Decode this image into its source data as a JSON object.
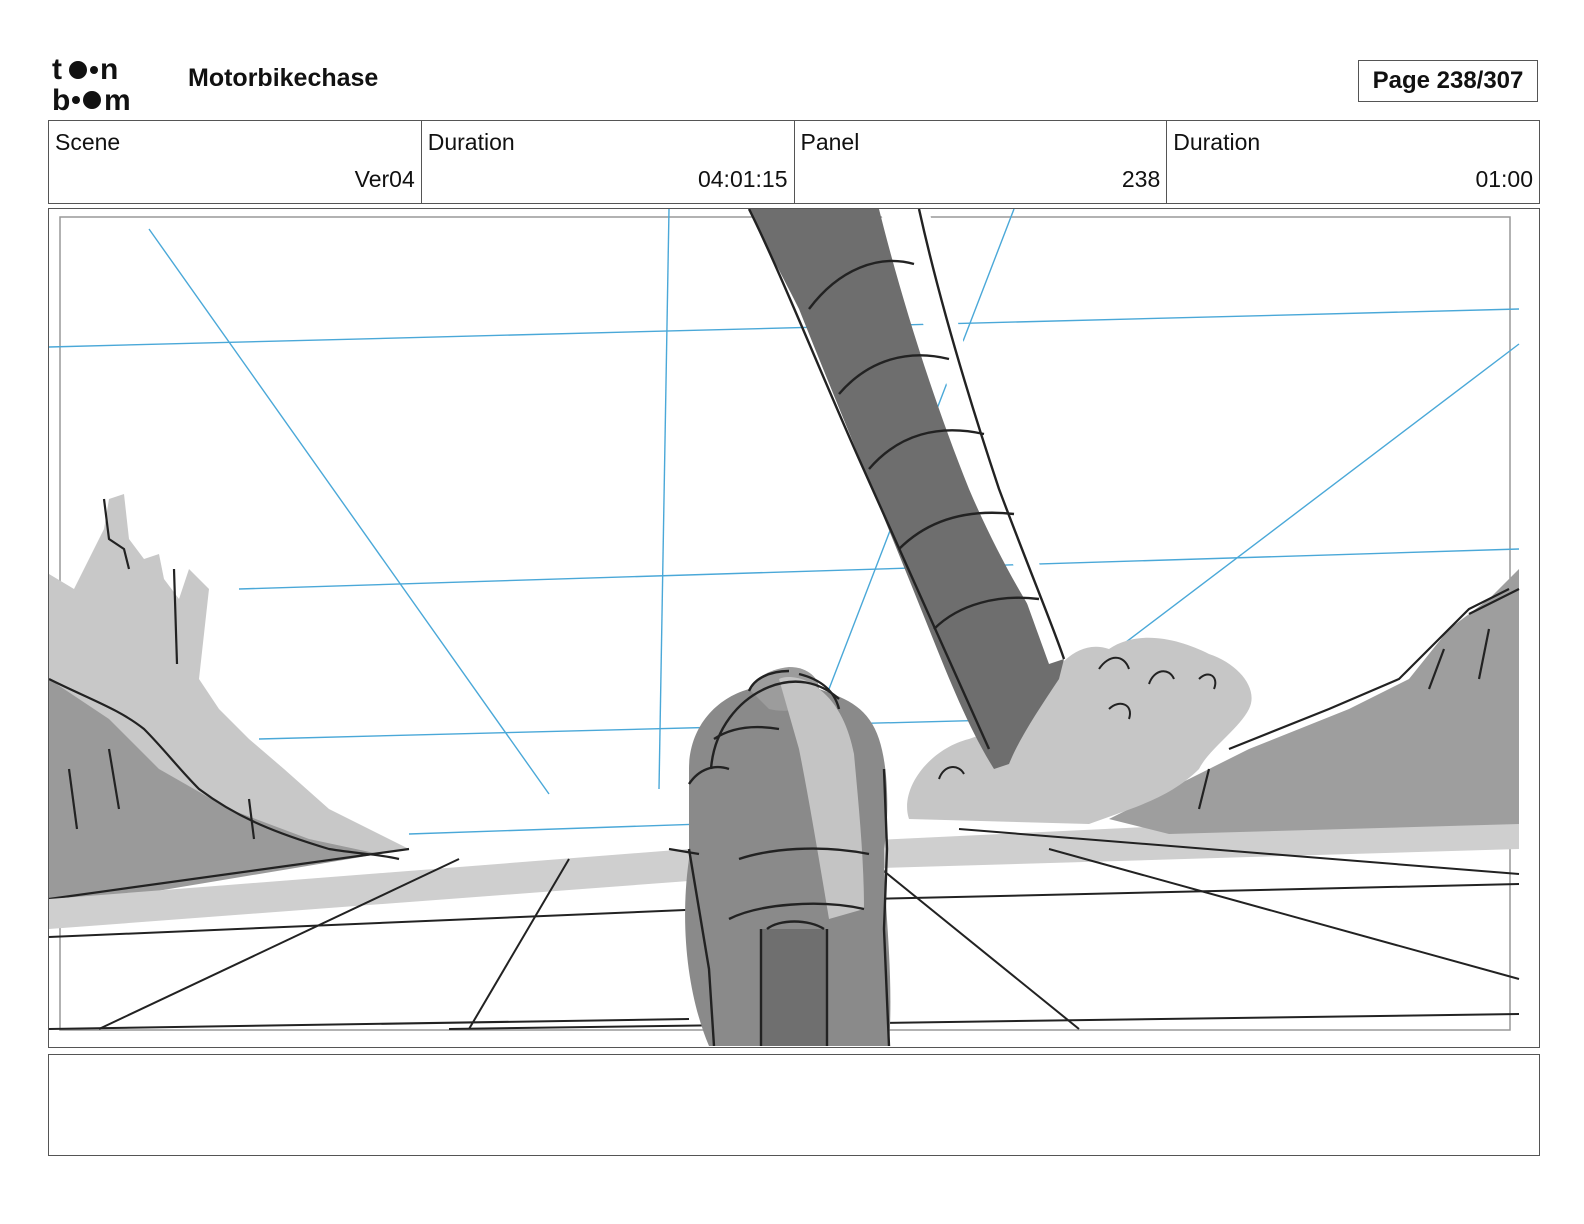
{
  "header": {
    "logo_text": "toonboom",
    "project_title": "Motorbikechase",
    "page_label": "Page 238/307"
  },
  "info": {
    "scene_label": "Scene",
    "scene_value": "Ver04",
    "scene_duration_label": "Duration",
    "scene_duration_value": "04:01:15",
    "panel_label": "Panel",
    "panel_value": "238",
    "panel_duration_label": "Duration",
    "panel_duration_value": "01:00"
  },
  "notes": {
    "text": ""
  },
  "colors": {
    "guide_blue": "#4aa8d8",
    "shade_light": "#c8c8c8",
    "shade_dark": "#6e6e6e"
  }
}
